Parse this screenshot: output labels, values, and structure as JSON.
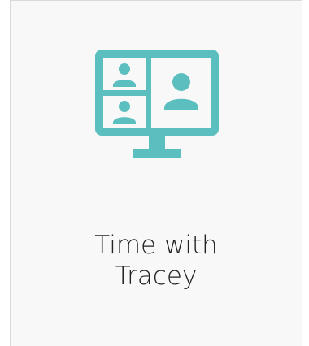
{
  "card": {
    "title_line1": "Time with",
    "title_line2": "Tracey",
    "icon": "video-conference-icon",
    "accent_color": "#5bbfbf"
  }
}
